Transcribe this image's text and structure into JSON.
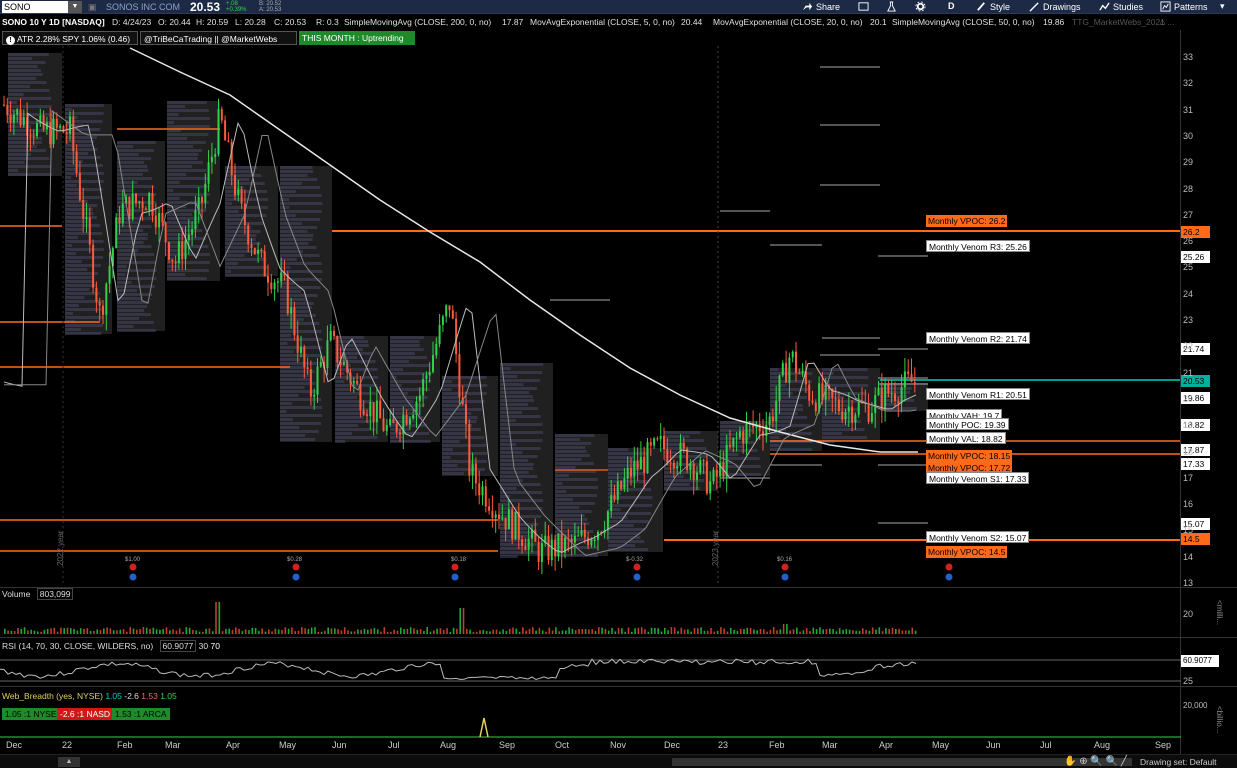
{
  "topbar": {
    "symbol": "SONO",
    "company": "SONOS INC COM",
    "last_price": "20.53",
    "change_top": "+.08",
    "change_pct": "+0.39%",
    "bid": "B: 20.52",
    "ask": "A: 20.53",
    "buttons": {
      "share": "Share",
      "style": "Style",
      "drawings": "Drawings",
      "studies": "Studies",
      "patterns": "Patterns",
      "aggregation": "D"
    }
  },
  "studybar": {
    "title": "SONO 10 Y 1D [NASDAQ]",
    "date": "D: 4/24/23",
    "open": "O: 20.44",
    "high": "H: 20.59",
    "low": "L: 20.28",
    "close": "C: 20.53",
    "range": "R: 0.3",
    "sma200": "SimpleMovingAvg (CLOSE, 200, 0, no)",
    "sma200_val": "17.87",
    "ema5": "MovAvgExponential (CLOSE, 5, 0, no)",
    "ema5_val": "20.44",
    "ema20": "MovAvgExponential (CLOSE, 20, 0, no)",
    "ema20_val": "20.1",
    "sma50": "SimpleMovingAvg (CLOSE, 50, 0, no)",
    "sma50_val": "19.86",
    "ttg": "TTG_MarketWebs_2021 ..."
  },
  "infobar": {
    "atr": "ATR 2.28% SPY 1.06% (0.46)",
    "handles": "@TriBeCaTrading || @MarketWebs",
    "trend": "THIS MONTH : Uptrending"
  },
  "annotations": [
    {
      "text": "Monthly VPOC: 26.2",
      "style": "o"
    },
    {
      "text": "Monthly Venom R3: 25.26",
      "style": "w"
    },
    {
      "text": "Monthly Venom R2: 21.74",
      "style": "w"
    },
    {
      "text": "Monthly Venom R1: 20.51",
      "style": "w"
    },
    {
      "text": "Monthly VAH: 19.7",
      "style": "w"
    },
    {
      "text": "Monthly POC: 19.39",
      "style": "w"
    },
    {
      "text": "Monthly VAL: 18.82",
      "style": "w"
    },
    {
      "text": "Monthly VPOC: 18.15",
      "style": "o"
    },
    {
      "text": "Monthly VPOC: 17.72",
      "style": "o"
    },
    {
      "text": "Monthly Venom S1: 17.33",
      "style": "w"
    },
    {
      "text": "Monthly Venom S2: 15.07",
      "style": "w"
    },
    {
      "text": "Monthly VPOC: 14.5",
      "style": "o"
    }
  ],
  "price_labels": [
    {
      "text": "26.2",
      "style": "o"
    },
    {
      "text": "25.26",
      "style": "w"
    },
    {
      "text": "21.74",
      "style": "w"
    },
    {
      "text": "20.53",
      "style": "g"
    },
    {
      "text": "19.86",
      "style": "w"
    },
    {
      "text": "18.82",
      "style": "w"
    },
    {
      "text": "17.87",
      "style": "w"
    },
    {
      "text": "17.33",
      "style": "w"
    },
    {
      "text": "15.07",
      "style": "w"
    },
    {
      "text": "14.5",
      "style": "o"
    }
  ],
  "price_axis": [
    "33",
    "32",
    "31",
    "30",
    "29",
    "28",
    "27",
    "26",
    "25",
    "24",
    "23",
    "22",
    "21",
    "20",
    "19",
    "18",
    "17",
    "16",
    "15",
    "14",
    "13"
  ],
  "events": [
    {
      "label": "$1.00"
    },
    {
      "label": "$0.28"
    },
    {
      "label": "$0.18"
    },
    {
      "label": "$-0.32"
    },
    {
      "label": "$0.16"
    }
  ],
  "year_markers": [
    "2022 year",
    "2023 year"
  ],
  "volume": {
    "title": "Volume",
    "value": "803,099",
    "axis": [
      "20"
    ],
    "unit": "<milli..."
  },
  "rsi": {
    "title": "RSI (14, 70, 30, CLOSE, WILDERS, no)",
    "value": "60.9077",
    "ob": "30",
    "os": "70",
    "axis_label": "60.9077",
    "axis_low": "25"
  },
  "breadth": {
    "title": "Web_Breadth (yes, NYSE)",
    "v1": "1.05",
    "v2": "-2.6",
    "v3": "1.53",
    "v4": "1.05",
    "boxes": [
      "1.05 :1 NYSE",
      "-2.6 :1 NASD",
      "1.53 :1 ARCA"
    ],
    "axis": "20,000",
    "unit": "<billio..."
  },
  "x_axis": [
    "Dec",
    "22",
    "Feb",
    "Mar",
    "Apr",
    "May",
    "Jun",
    "Jul",
    "Aug",
    "Sep",
    "Oct",
    "Nov",
    "Dec",
    "23",
    "Feb",
    "Mar",
    "Apr",
    "May",
    "Jun",
    "Jul",
    "Aug",
    "Sep"
  ],
  "bottombar": {
    "drawing_set": "Drawing set: Default"
  },
  "colors": {
    "orange": "#ff6a1a",
    "teal": "#00d0c0",
    "candle_up": "#2fd24a",
    "candle_down": "#ff5a3a"
  }
}
